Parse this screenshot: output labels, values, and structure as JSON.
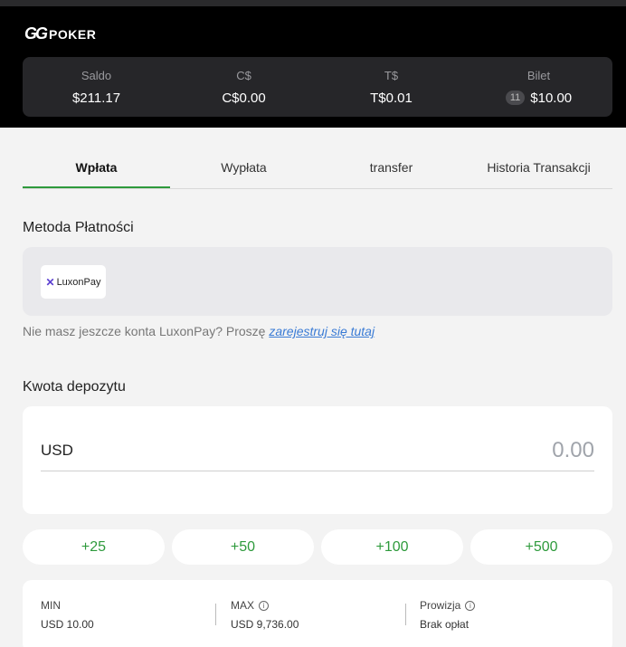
{
  "brand": {
    "logo_gg": "GG",
    "logo_poker": "POKER"
  },
  "balance": [
    {
      "label": "Saldo",
      "value": "$211.17"
    },
    {
      "label": "C$",
      "value": "C$0.00"
    },
    {
      "label": "T$",
      "value": "T$0.01"
    },
    {
      "label": "Bilet",
      "badge": "11",
      "value": "$10.00"
    }
  ],
  "tabs": [
    {
      "label": "Wpłata",
      "active": true
    },
    {
      "label": "Wypłata"
    },
    {
      "label": "transfer"
    },
    {
      "label": "Historia Transakcji"
    }
  ],
  "payment": {
    "title": "Metoda Płatności",
    "method_mark": "✕",
    "method_name": "LuxonPay",
    "note": "Nie masz jeszcze konta LuxonPay? Proszę ",
    "register_link": "zarejestruj się tutaj"
  },
  "deposit": {
    "title": "Kwota depozytu",
    "currency": "USD",
    "placeholder": "0.00",
    "quick_amounts": [
      "+25",
      "+50",
      "+100",
      "+500"
    ]
  },
  "limits": {
    "min_label": "MIN",
    "min_value": "USD 10.00",
    "max_label": "MAX",
    "max_value": "USD 9,736.00",
    "fee_label": "Prowizja",
    "fee_value": "Brak opłat"
  },
  "colors": {
    "accent": "#2e9a3c",
    "link": "#3a7bd5",
    "header_bg": "#000000",
    "balance_bg": "#262629"
  }
}
